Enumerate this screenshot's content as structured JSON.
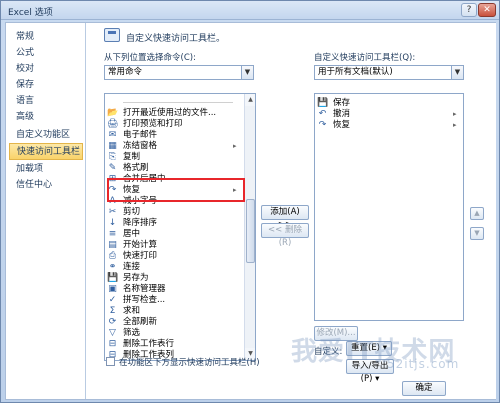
{
  "window": {
    "title": "Excel 选项",
    "help_glyph": "?",
    "close_glyph": "✕"
  },
  "nav": {
    "items": [
      {
        "label": "常规"
      },
      {
        "label": "公式"
      },
      {
        "label": "校对"
      },
      {
        "label": "保存"
      },
      {
        "label": "语言"
      },
      {
        "label": "高级"
      },
      {
        "label": "自定义功能区"
      },
      {
        "label": "快速访问工具栏",
        "active": true
      },
      {
        "label": "加载项"
      },
      {
        "label": "信任中心"
      }
    ]
  },
  "main": {
    "heading": "自定义快速访问工具栏。",
    "choose_label": "从下列位置选择命令(C):",
    "choose_value": "常用命令",
    "customize_label": "自定义快速访问工具栏(Q):",
    "customize_value": "用于所有文档(默认)",
    "commands": [
      {
        "icon": "separator-icon",
        "glyph": "",
        "label": "<分隔符>"
      },
      {
        "icon": "folder-icon",
        "glyph": "📂",
        "label": "打开最近使用过的文件..."
      },
      {
        "icon": "print-preview-icon",
        "glyph": "🖨",
        "label": "打印预览和打印"
      },
      {
        "icon": "email-icon",
        "glyph": "✉",
        "label": "电子邮件"
      },
      {
        "icon": "freeze-panes-icon",
        "glyph": "▦",
        "label": "冻结窗格",
        "submenu": true
      },
      {
        "icon": "copy-icon",
        "glyph": "⎘",
        "label": "复制"
      },
      {
        "icon": "format-painter-icon",
        "glyph": "✎",
        "label": "格式刷"
      },
      {
        "icon": "merge-center-icon",
        "glyph": "⊞",
        "label": "合并后居中"
      },
      {
        "icon": "redo-icon",
        "glyph": "↷",
        "label": "恢复",
        "submenu": true
      },
      {
        "icon": "decrease-font-icon",
        "glyph": "A",
        "label": "减小字号"
      },
      {
        "icon": "cut-icon",
        "glyph": "✂",
        "label": "剪切"
      },
      {
        "icon": "sort-descending-icon",
        "glyph": "↓",
        "label": "降序排序"
      },
      {
        "icon": "center-icon",
        "glyph": "≡",
        "label": "居中"
      },
      {
        "icon": "calculate-now-icon",
        "glyph": "▤",
        "label": "开始计算"
      },
      {
        "icon": "quick-print-icon",
        "glyph": "⎙",
        "label": "快速打印"
      },
      {
        "icon": "link-icon",
        "glyph": "⚭",
        "label": "连接"
      },
      {
        "icon": "save-as-icon",
        "glyph": "💾",
        "label": "另存为"
      },
      {
        "icon": "name-manager-icon",
        "glyph": "▣",
        "label": "名称管理器"
      },
      {
        "icon": "spelling-icon",
        "glyph": "✓",
        "label": "拼写检查..."
      },
      {
        "icon": "sum-icon",
        "glyph": "Σ",
        "label": "求和"
      },
      {
        "icon": "refresh-all-icon",
        "glyph": "⟳",
        "label": "全部刷新"
      },
      {
        "icon": "filter-icon",
        "glyph": "▽",
        "label": "筛选"
      },
      {
        "icon": "delete-sheet-rows-icon",
        "glyph": "⊟",
        "label": "删除工作表行"
      },
      {
        "icon": "delete-sheet-columns-icon",
        "glyph": "⊟",
        "label": "删除工作表列"
      }
    ],
    "toolbar_items": [
      {
        "icon": "save-icon",
        "glyph": "💾",
        "label": "保存"
      },
      {
        "icon": "undo-icon",
        "glyph": "↶",
        "label": "撤消",
        "submenu": true
      },
      {
        "icon": "redo-icon",
        "glyph": "↷",
        "label": "恢复",
        "submenu": true
      }
    ],
    "add_label": "添加(A) >>",
    "remove_label": "<< 删除(R)",
    "modify_label": "修改(M)...",
    "customize_row_label": "自定义:",
    "reset_label": "重置(E) ▾",
    "import_export_label": "导入/导出(P) ▾",
    "show_below_ribbon_label": "在功能区下方显示快速访问工具栏(H)",
    "ok_label": "确定",
    "move_up_glyph": "▲",
    "move_down_glyph": "▼"
  },
  "watermark": {
    "text": "我爱IT技术网",
    "sub": "52itjs.com"
  }
}
